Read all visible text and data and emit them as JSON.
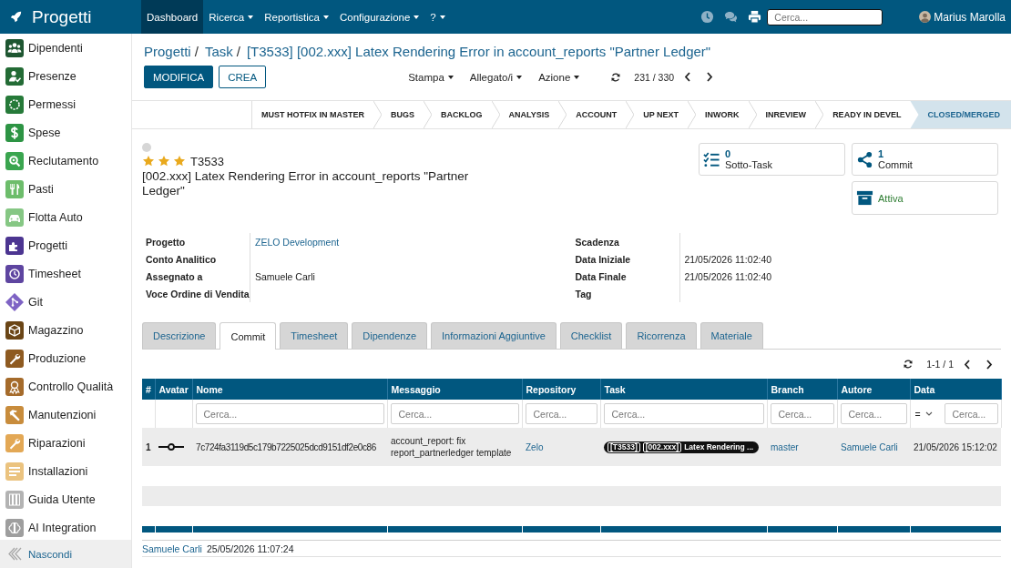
{
  "topbar": {
    "brand": "Progetti",
    "menu": [
      {
        "label": "Dashboard",
        "selected": true,
        "dropdown": false
      },
      {
        "label": "Ricerca",
        "selected": false,
        "dropdown": true
      },
      {
        "label": "Reportistica",
        "selected": false,
        "dropdown": true
      },
      {
        "label": "Configurazione",
        "selected": false,
        "dropdown": true
      },
      {
        "label": "?",
        "selected": false,
        "dropdown": true
      }
    ],
    "search": {
      "placeholder": "Cerca..."
    },
    "user": "Marius Marolla"
  },
  "sidebar": {
    "items": [
      {
        "label": "Dipendenti",
        "color": "#1e5631"
      },
      {
        "label": "Presenze",
        "color": "#236b35"
      },
      {
        "label": "Permessi",
        "color": "#267a39"
      },
      {
        "label": "Spese",
        "color": "#2d9444"
      },
      {
        "label": "Reclutamento",
        "color": "#3aa54f"
      },
      {
        "label": "Pasti",
        "color": "#6dbd6b"
      },
      {
        "label": "Flotta Auto",
        "color": "#86c784"
      },
      {
        "label": "Progetti",
        "color": "#4c3591"
      },
      {
        "label": "Timesheet",
        "color": "#5e45a0"
      },
      {
        "label": "Git",
        "color": "#7e63c4"
      },
      {
        "label": "Magazzino",
        "color": "#6a4516"
      },
      {
        "label": "Produzione",
        "color": "#8e5a20"
      },
      {
        "label": "Controllo Qualità",
        "color": "#a56b2b"
      },
      {
        "label": "Manutenzioni",
        "color": "#c88c3c"
      },
      {
        "label": "Riparazioni",
        "color": "#e3a855"
      },
      {
        "label": "Installazioni",
        "color": "#ebc37f"
      },
      {
        "label": "Guida Utente",
        "color": "#b3b3b3"
      },
      {
        "label": "AI Integration",
        "color": "#9e9e9e"
      }
    ],
    "collapse": "Nascondi"
  },
  "breadcrumb": [
    {
      "label": "Progetti",
      "separator": "/"
    },
    {
      "label": "Task",
      "separator": "/"
    },
    {
      "label": "[T3533] [002.xxx] Latex Rendering Error in account_reports \"Partner Ledger\""
    }
  ],
  "buttons": [
    {
      "label": "MODIFICA",
      "kind": "primary"
    },
    {
      "label": "CREA",
      "kind": "secondary"
    }
  ],
  "toolbar": [
    "Stampa",
    "Allegato/i",
    "Azione"
  ],
  "pager": "231 / 330",
  "stages": [
    {
      "label": "MUST HOTFIX IN MASTER",
      "selected": false
    },
    {
      "label": "BUGS",
      "selected": false
    },
    {
      "label": "BACKLOG",
      "selected": false
    },
    {
      "label": "ANALYSIS",
      "selected": false
    },
    {
      "label": "ACCOUNT",
      "selected": false
    },
    {
      "label": "UP NEXT",
      "selected": false
    },
    {
      "label": "INWORK",
      "selected": false
    },
    {
      "label": "INREVIEW",
      "selected": false
    },
    {
      "label": "READY IN DEVEL",
      "selected": false
    },
    {
      "label": "CLOSED/MERGED",
      "selected": true
    }
  ],
  "record": {
    "kanban_done": false,
    "stars": 3,
    "ref": "T3533",
    "title": "[002.xxx] Latex Rendering Error in account_reports \"Partner Ledger\""
  },
  "smart_buttons": [
    {
      "kind": "counter",
      "value": "0",
      "label": "Sotto-Task"
    },
    {
      "kind": "counter",
      "value": "1",
      "label": "Commit"
    },
    {
      "kind": "toggle",
      "label": "Attiva",
      "active": true
    }
  ],
  "fields": {
    "left": [
      {
        "label": "Progetto",
        "value": "ZELO Development",
        "link": true
      },
      {
        "label": "Conto Analitico"
      },
      {
        "label": "Assegnato a",
        "value": "Samuele Carli",
        "link": false
      },
      {
        "label": "Voce Ordine di Vendita"
      }
    ],
    "right": [
      {
        "label": "Scadenza"
      },
      {
        "label": "Data Iniziale",
        "value": "21/05/2026 11:02:40"
      },
      {
        "label": "Data Finale",
        "value": "21/05/2026 11:02:40"
      },
      {
        "label": "Tag"
      }
    ]
  },
  "tabs": [
    {
      "label": "Descrizione",
      "selected": false
    },
    {
      "label": "Commit",
      "selected": true
    },
    {
      "label": "Timesheet",
      "selected": false
    },
    {
      "label": "Dipendenze",
      "selected": false
    },
    {
      "label": "Informazioni Aggiuntive",
      "selected": false
    },
    {
      "label": "Checklist",
      "selected": false
    },
    {
      "label": "Ricorrenza",
      "selected": false
    },
    {
      "label": "Materiale",
      "selected": false
    }
  ],
  "commits": {
    "pager": "1-1 / 1",
    "columns": [
      "#",
      "Avatar",
      "Nome",
      "Messaggio",
      "Repository",
      "Task",
      "Branch",
      "Autore",
      "Data"
    ],
    "filters": [
      {
        "placeholder": "Cerca..."
      },
      {
        "placeholder": "Cerca..."
      },
      {
        "placeholder": "Cerca..."
      },
      {
        "placeholder": "Cerca..."
      },
      {
        "placeholder": "Cerca..."
      },
      {
        "placeholder": "Cerca..."
      },
      {
        "operator": "=",
        "placeholder": "Cerca..."
      }
    ],
    "rows": [
      {
        "number": "1",
        "hash": "7c724fa3119d5c179b7225025dcd9151df2e0c86",
        "message": "account_report: fix report_partnerledger template",
        "repository": "Zelo",
        "task_tags": [
          "[T3533]",
          "[002.xxx]"
        ],
        "task_text": "Latex Rendering ...",
        "branch": "master",
        "author": "Samuele Carli",
        "date": "21/05/2026 15:12:02"
      }
    ]
  },
  "footer": {
    "author": "Samuele Carli",
    "date": "25/05/2026 11:07:24"
  }
}
